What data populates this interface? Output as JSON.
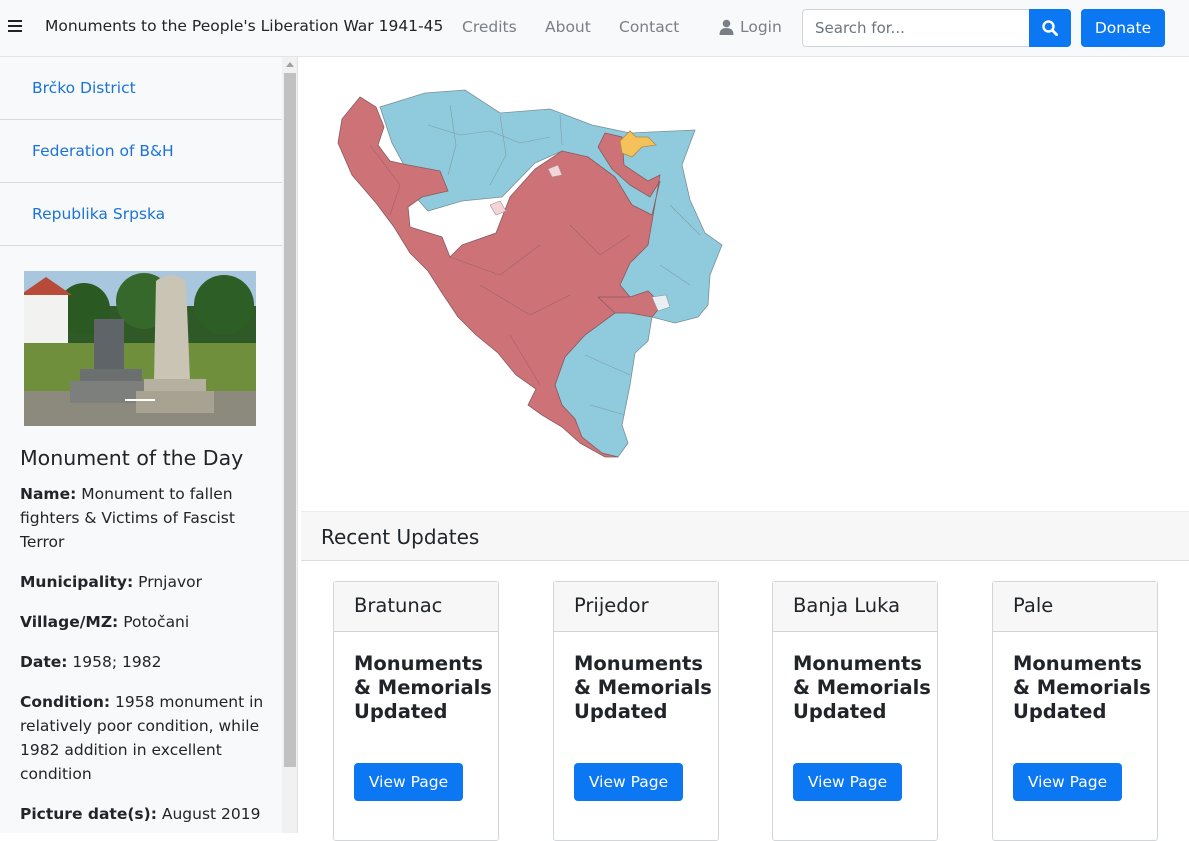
{
  "navbar": {
    "menu_icon": "hamburger-icon",
    "brand": "Monuments to the People's Liberation War 1941-45",
    "links": [
      "Credits",
      "About",
      "Contact"
    ],
    "login": "Login",
    "login_icon": "user-icon",
    "search_placeholder": "Search for...",
    "search_icon": "search-icon",
    "donate": "Donate",
    "accent_color": "#0b77f3"
  },
  "sidebar": {
    "items": [
      {
        "label": "Brčko District"
      },
      {
        "label": "Federation of B&H"
      },
      {
        "label": "Republika Srpska"
      }
    ],
    "motd": {
      "heading": "Monument of the Day",
      "fields": [
        {
          "label": "Name:",
          "value": "Monument to fallen fighters & Victims of Fascist Terror"
        },
        {
          "label": "Municipality:",
          "value": "Prnjavor"
        },
        {
          "label": "Village/MZ:",
          "value": "Potočani"
        },
        {
          "label": "Date:",
          "value": "1958; 1982"
        },
        {
          "label": "Condition:",
          "value": "1958 monument in relatively poor condition, while 1982 addition in excellent condition"
        },
        {
          "label": "Picture date(s):",
          "value": "August 2019"
        }
      ]
    }
  },
  "map": {
    "regions": [
      {
        "name": "Republika Srpska",
        "color": "#cd7378"
      },
      {
        "name": "Federation of B&H",
        "color": "#8fcbdc"
      },
      {
        "name": "Brčko District",
        "color": "#f5c15a"
      }
    ]
  },
  "updates": {
    "heading": "Recent Updates",
    "cards": [
      {
        "title": "Bratunac",
        "text": "Monuments & Memorials Updated",
        "button": "View Page"
      },
      {
        "title": "Prijedor",
        "text": "Monuments & Memorials Updated",
        "button": "View Page"
      },
      {
        "title": "Banja Luka",
        "text": "Monuments & Memorials Updated",
        "button": "View Page"
      },
      {
        "title": "Pale",
        "text": "Monuments & Memorials Updated",
        "button": "View Page"
      }
    ]
  }
}
